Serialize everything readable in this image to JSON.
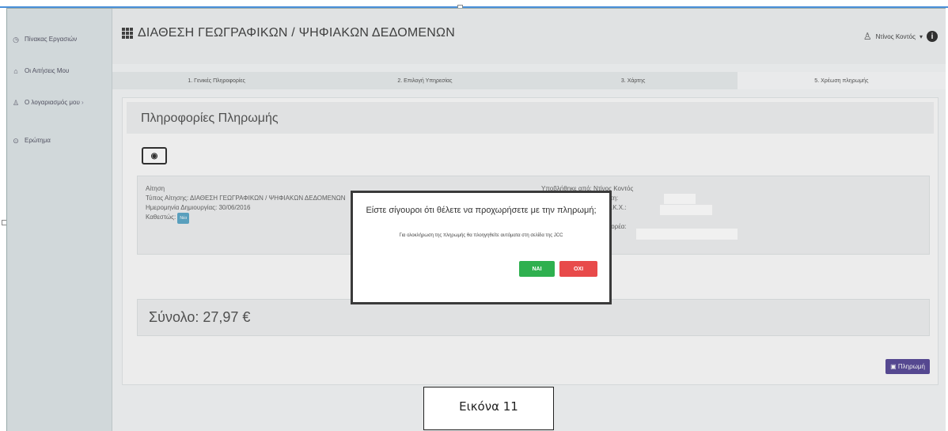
{
  "sidebar": {
    "items": [
      {
        "icon": "dashboard-icon",
        "label": "Πίνακας Εργασιών"
      },
      {
        "icon": "bank-icon",
        "label": "Οι Αιτήσεις Μου"
      },
      {
        "icon": "user-icon",
        "label": "Ο λογαριασμός μου"
      },
      {
        "icon": "question-icon",
        "label": "Ερώτημα"
      }
    ]
  },
  "header": {
    "title": "ΔΙΑΘΕΣΗ ΓΕΩΓΡΑΦΙΚΩΝ / ΨΗΦΙΑΚΩΝ ΔΕΔΟΜΕΝΩΝ",
    "user_name": "Ντίνος Κοντός"
  },
  "tabs": [
    {
      "label": "1. Γενικές Πληροφορίες"
    },
    {
      "label": "2. Επιλογή Υπηρεσίας"
    },
    {
      "label": "3. Χάρτης"
    },
    {
      "label": "5. Χρέωση πληρωμής"
    }
  ],
  "panel": {
    "title": "Πληροφορίες Πληρωμής",
    "application": {
      "heading": "Αίτηση",
      "type_line": "Τύπος Αίτησης: ΔΙΑΘΕΣΗ ΓΕΩΓΡΑΦΙΚΩΝ / ΨΗΦΙΑΚΩΝ ΔΕΔΟΜΕΝΩΝ",
      "date_line": "Ημερομηνία Δημιουργίας: 30/06/2016",
      "status_label": "Καθεστώς:",
      "status_badge": "Νέα",
      "submitted_by": "Υποβλήθηκε από: Ντίνος Κοντός",
      "client_line": "Αριθμός Εγγραφής Πελάτη:",
      "tkx_line": "Αριθμός Εγγραφής στο Τ.Κ.Χ.:",
      "other_line": "Όνομα Αντιπροσώπου/Φορέα:"
    },
    "total": "Σύνολο: 27,97 €",
    "pay_button": "Πληρωμή"
  },
  "modal": {
    "title": "Είστε σίγουροι ότι θέλετε να προχωρήσετε με την πληρωμή;",
    "subtitle": "Για ολοκλήρωση της πληρωμής θα πλοηγηθείτε αυτόματα στη σελίδα της JCC",
    "yes_label": "ΝΑΙ",
    "no_label": "ΟΧΙ"
  },
  "caption": "Εικόνα 11"
}
